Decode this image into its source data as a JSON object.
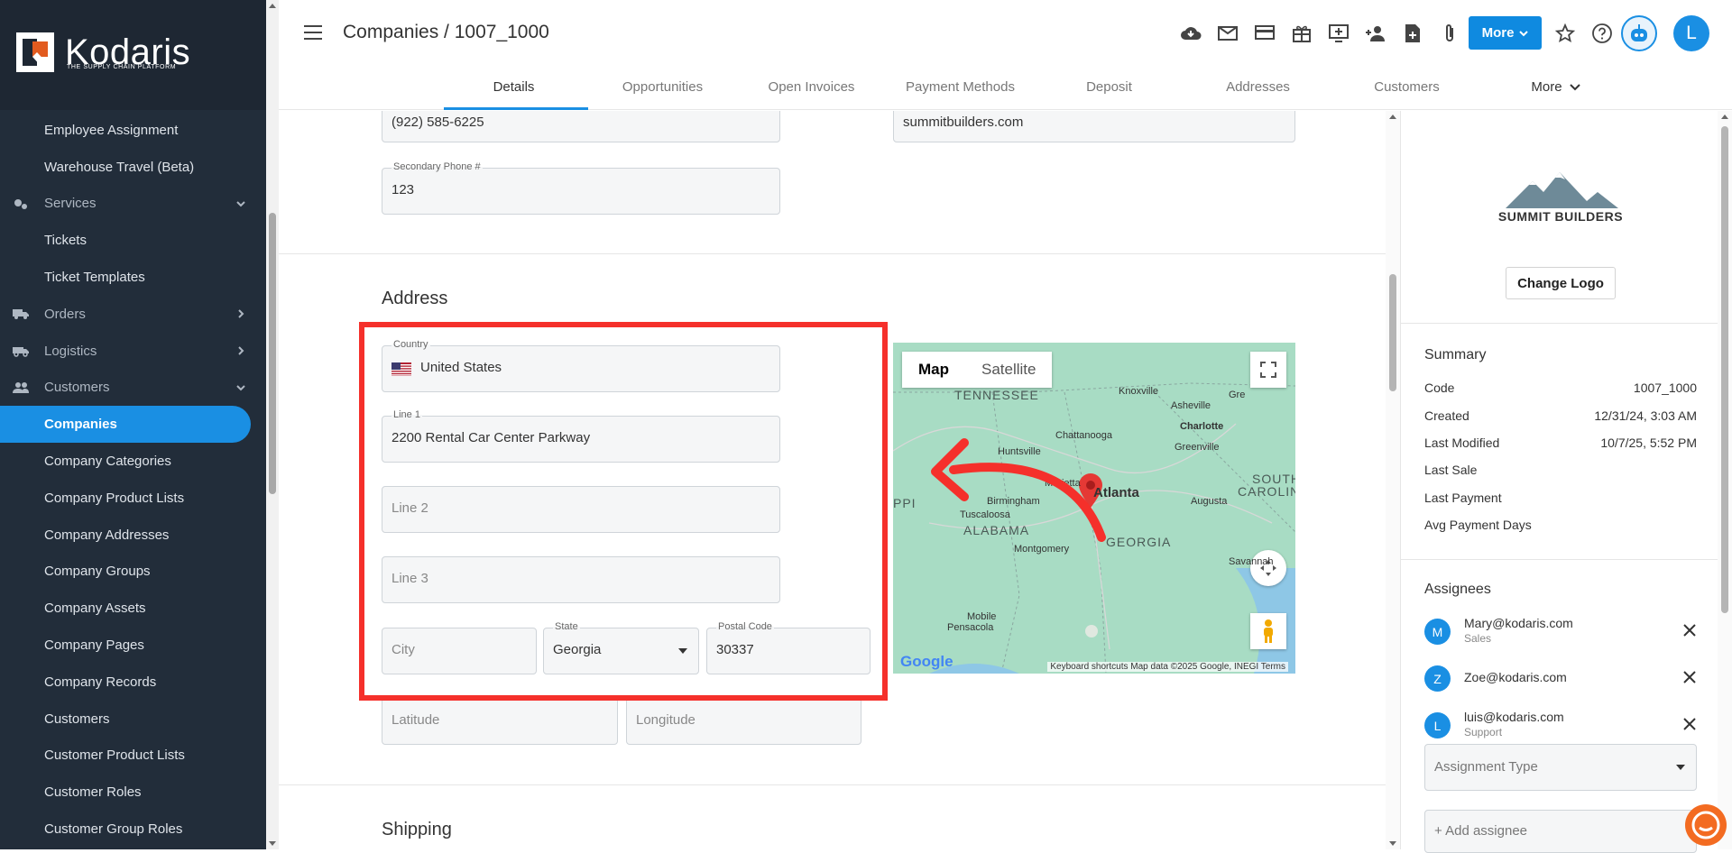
{
  "brand": {
    "name": "Kodaris",
    "tagline": "THE SUPPLY CHAIN PLATFORM"
  },
  "sidebar": {
    "items": [
      {
        "label": "Employee Assignment",
        "kind": "sub"
      },
      {
        "label": "Warehouse Travel (Beta)",
        "kind": "sub"
      },
      {
        "label": "Services",
        "kind": "group",
        "icon": "services-icon",
        "chevron": "down"
      },
      {
        "label": "Tickets",
        "kind": "sub"
      },
      {
        "label": "Ticket Templates",
        "kind": "sub"
      },
      {
        "label": "Orders",
        "kind": "group",
        "icon": "truck-icon",
        "chevron": "right"
      },
      {
        "label": "Logistics",
        "kind": "group",
        "icon": "logistics-icon",
        "chevron": "right"
      },
      {
        "label": "Customers",
        "kind": "group",
        "icon": "people-icon",
        "chevron": "down"
      },
      {
        "label": "Companies",
        "kind": "sub",
        "active": true
      },
      {
        "label": "Company Categories",
        "kind": "sub"
      },
      {
        "label": "Company Product Lists",
        "kind": "sub"
      },
      {
        "label": "Company Addresses",
        "kind": "sub"
      },
      {
        "label": "Company Groups",
        "kind": "sub"
      },
      {
        "label": "Company Assets",
        "kind": "sub"
      },
      {
        "label": "Company Pages",
        "kind": "sub"
      },
      {
        "label": "Company Records",
        "kind": "sub"
      },
      {
        "label": "Customers",
        "kind": "sub"
      },
      {
        "label": "Customer Product Lists",
        "kind": "sub"
      },
      {
        "label": "Customer Roles",
        "kind": "sub"
      },
      {
        "label": "Customer Group Roles",
        "kind": "sub"
      }
    ]
  },
  "header": {
    "breadcrumb": "Companies / 1007_1000",
    "more_label": "More",
    "avatar_letter": "L",
    "icons": [
      "cloud-icon",
      "mail-icon",
      "card-icon",
      "gift-icon",
      "screen-add-icon",
      "person-add-icon",
      "file-add-icon",
      "attachment-icon"
    ]
  },
  "tabs": [
    "Details",
    "Opportunities",
    "Open Invoices",
    "Payment Methods",
    "Deposit",
    "Addresses",
    "Customers",
    "More"
  ],
  "contact": {
    "phone": "(922) 585-6225",
    "website": "summitbuilders.com",
    "secondary_phone_label": "Secondary Phone #",
    "secondary_phone": "123"
  },
  "address": {
    "title": "Address",
    "country_label": "Country",
    "country": "United States",
    "line1_label": "Line 1",
    "line1": "2200 Rental Car Center Parkway",
    "line2_placeholder": "Line 2",
    "line3_placeholder": "Line 3",
    "city_placeholder": "City",
    "state_label": "State",
    "state": "Georgia",
    "postal_label": "Postal Code",
    "postal": "30337",
    "latitude_placeholder": "Latitude",
    "longitude_placeholder": "Longitude"
  },
  "map": {
    "map_tab": "Map",
    "satellite_tab": "Satellite",
    "labels": [
      "TENNESSEE",
      "Knoxville",
      "Asheville",
      "Charlotte",
      "Chattanooga",
      "Greenville",
      "Huntsville",
      "Marietta",
      "Atlanta",
      "SOUTH",
      "CAROLINA",
      "Augusta",
      "Birmingham",
      "Tuscaloosa",
      "ALABAMA",
      "GEORGIA",
      "Montgomery",
      "Savannah",
      "Mobile",
      "Pensacola",
      "PPI",
      "Gre"
    ],
    "footer": "Keyboard shortcuts   Map data ©2025 Google, INEGI   Terms",
    "google": "Google"
  },
  "shipping": {
    "title": "Shipping"
  },
  "right_panel": {
    "company_logo_text": "SUMMIT BUILDERS",
    "change_logo": "Change Logo",
    "summary_title": "Summary",
    "summary": [
      {
        "label": "Code",
        "value": "1007_1000"
      },
      {
        "label": "Created",
        "value": "12/31/24, 3:03 AM"
      },
      {
        "label": "Last Modified",
        "value": "10/7/25, 5:52 PM"
      },
      {
        "label": "Last Sale",
        "value": ""
      },
      {
        "label": "Last Payment",
        "value": ""
      },
      {
        "label": "Avg Payment Days",
        "value": ""
      }
    ],
    "assignees_title": "Assignees",
    "assignees": [
      {
        "letter": "M",
        "email": "Mary@kodaris.com",
        "role": "Sales"
      },
      {
        "letter": "Z",
        "email": "Zoe@kodaris.com",
        "role": ""
      },
      {
        "letter": "L",
        "email": "luis@kodaris.com",
        "role": "Support"
      }
    ],
    "assignment_type_placeholder": "Assignment Type",
    "add_assignee": "+ Add assignee"
  },
  "colors": {
    "accent": "#1a8fe3",
    "sidebar": "#222d3a",
    "highlight": "#f5302b"
  }
}
